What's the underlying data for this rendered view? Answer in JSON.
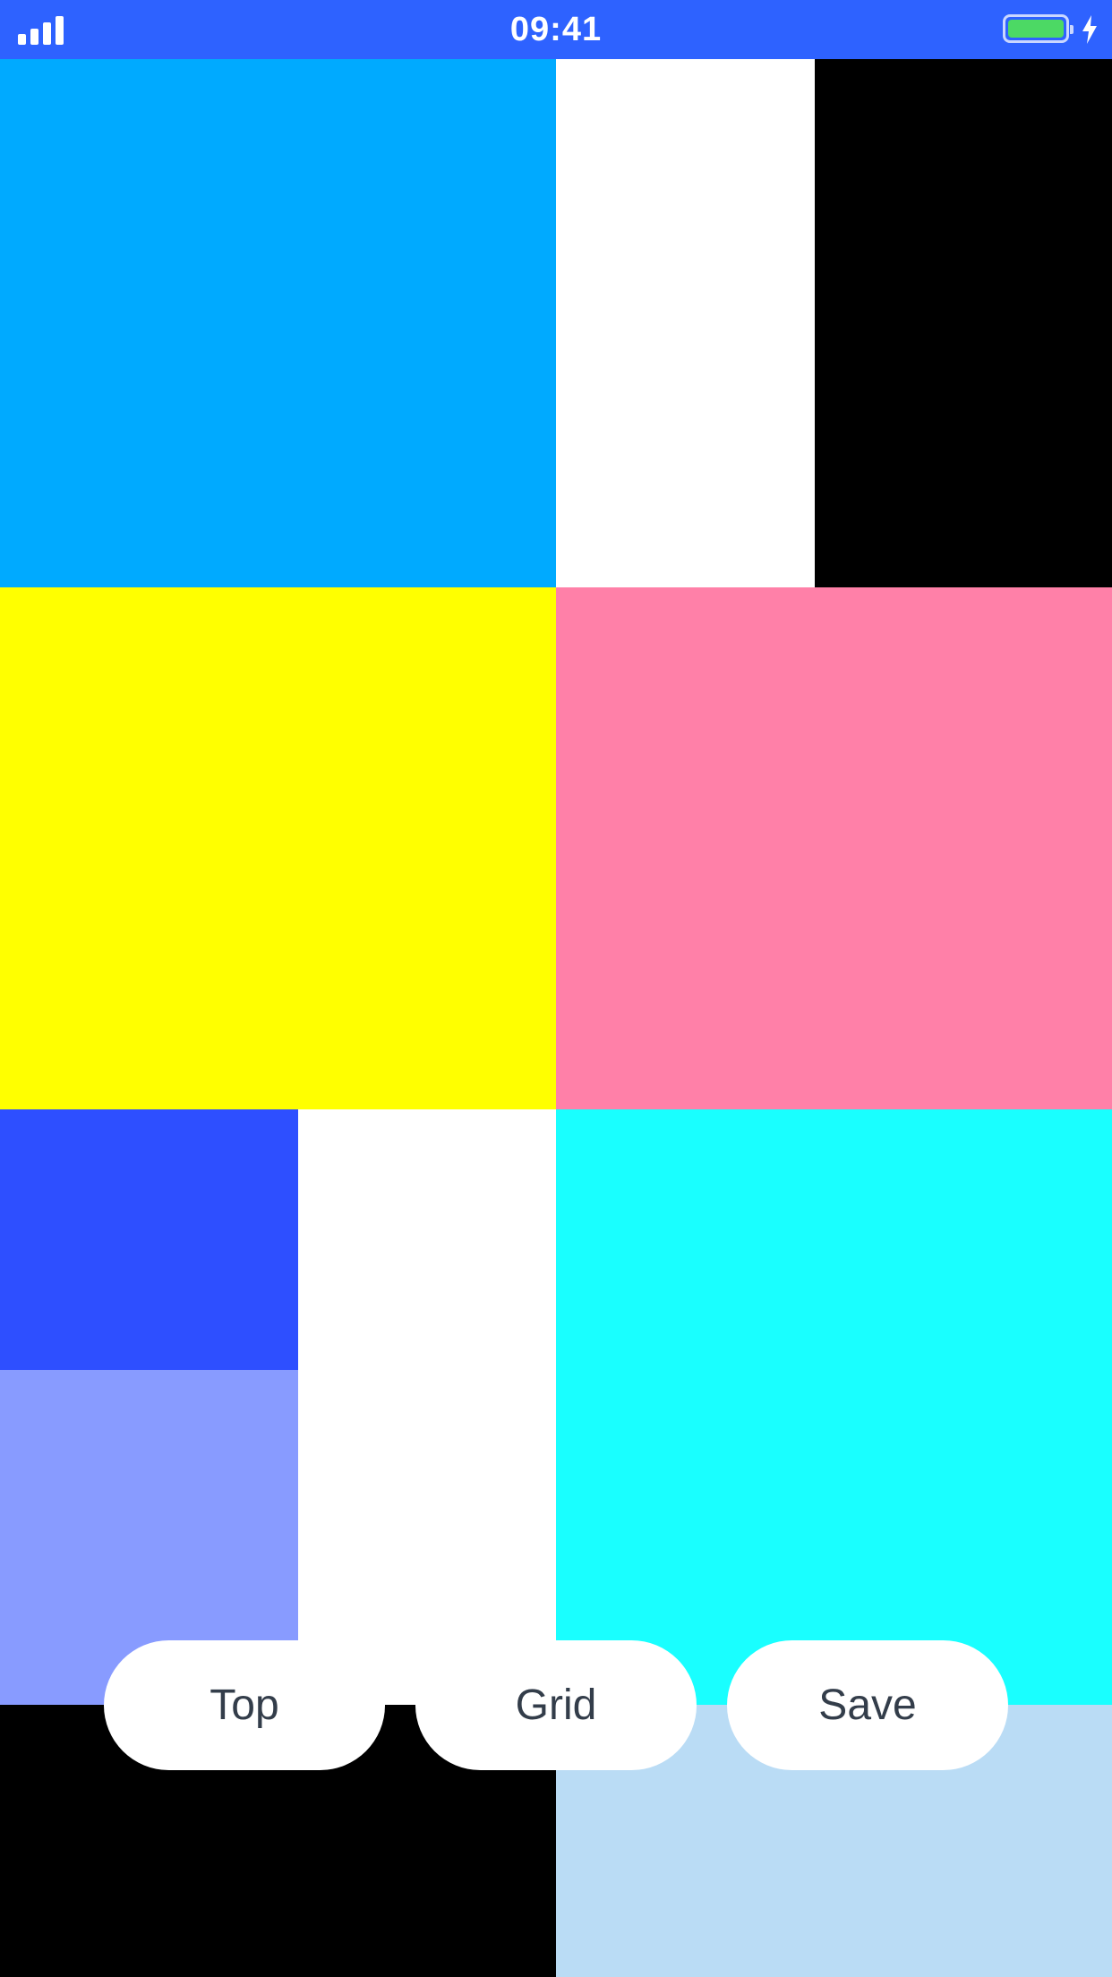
{
  "status_bar": {
    "time": "09:41",
    "signal_icon": "cellular-signal-icon",
    "battery_icon": "battery-charging-icon",
    "charging_icon": "lightning-bolt-icon",
    "background_color": "#2e62ff"
  },
  "tiles": [
    {
      "name": "tile-sky-blue",
      "color": "#00aaff"
    },
    {
      "name": "tile-white-top",
      "color": "#ffffff"
    },
    {
      "name": "tile-black-top",
      "color": "#000000"
    },
    {
      "name": "tile-yellow",
      "color": "#ffff00"
    },
    {
      "name": "tile-pink",
      "color": "#ff80a8"
    },
    {
      "name": "tile-royal-blue",
      "color": "#2e4fff"
    },
    {
      "name": "tile-periwinkle",
      "color": "#889bff"
    },
    {
      "name": "tile-white-middle",
      "color": "#ffffff"
    },
    {
      "name": "tile-cyan",
      "color": "#19ffff"
    },
    {
      "name": "tile-black-bottom",
      "color": "#000000"
    },
    {
      "name": "tile-light-blue",
      "color": "#badcf5"
    }
  ],
  "buttons": {
    "top": "Top",
    "grid": "Grid",
    "save": "Save"
  }
}
